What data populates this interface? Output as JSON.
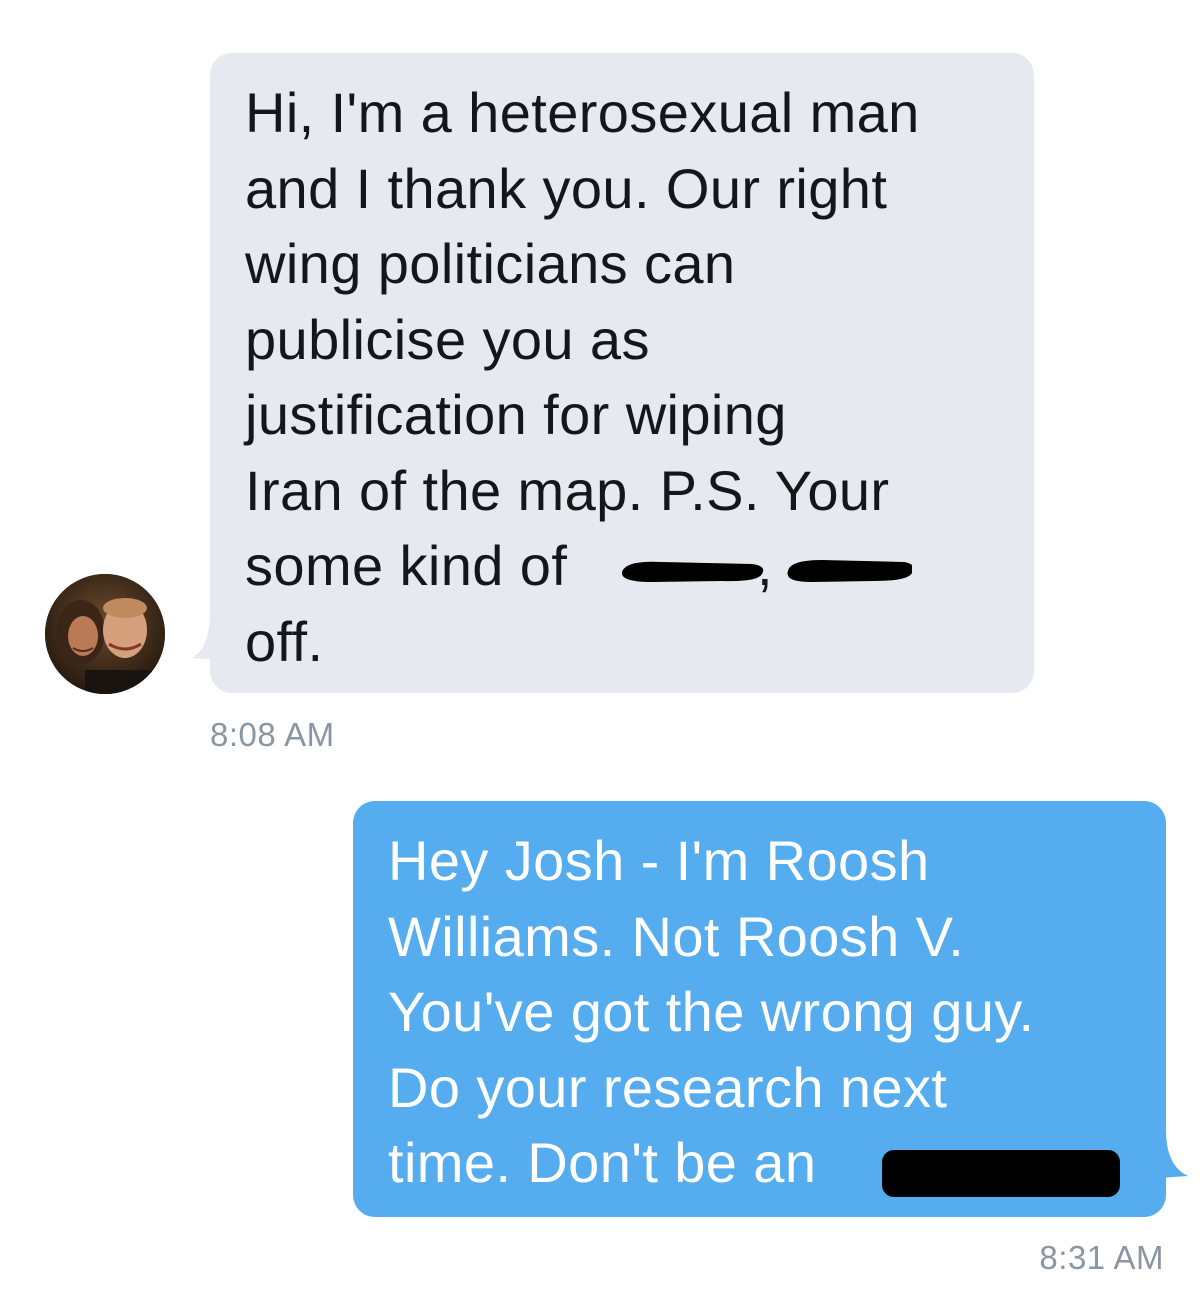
{
  "conversation": {
    "incoming": {
      "lines": [
        "Hi, I'm a heterosexual man",
        "and I thank you. Our right",
        "wing politicians can",
        "publicise you as",
        "justification for wiping",
        "Iran of the map. P.S. Your",
        "some kind of",
        "off."
      ],
      "redacted_words_visible_fragment": ",",
      "timestamp": "8:08 AM",
      "bubble_color": "#e6e9ef",
      "text_color": "#14171a"
    },
    "outgoing": {
      "lines": [
        "Hey Josh - I'm Roosh",
        "Williams. Not Roosh V.",
        "You've got the wrong guy.",
        "Do your research next",
        "time. Don't be an"
      ],
      "timestamp": "8:31 AM",
      "bubble_color": "#55acee",
      "text_color": "#ffffff"
    },
    "avatar": {
      "icon": "profile-photo-avatar"
    },
    "timestamp_color": "#8a96a3",
    "redaction_color": "#000000"
  }
}
